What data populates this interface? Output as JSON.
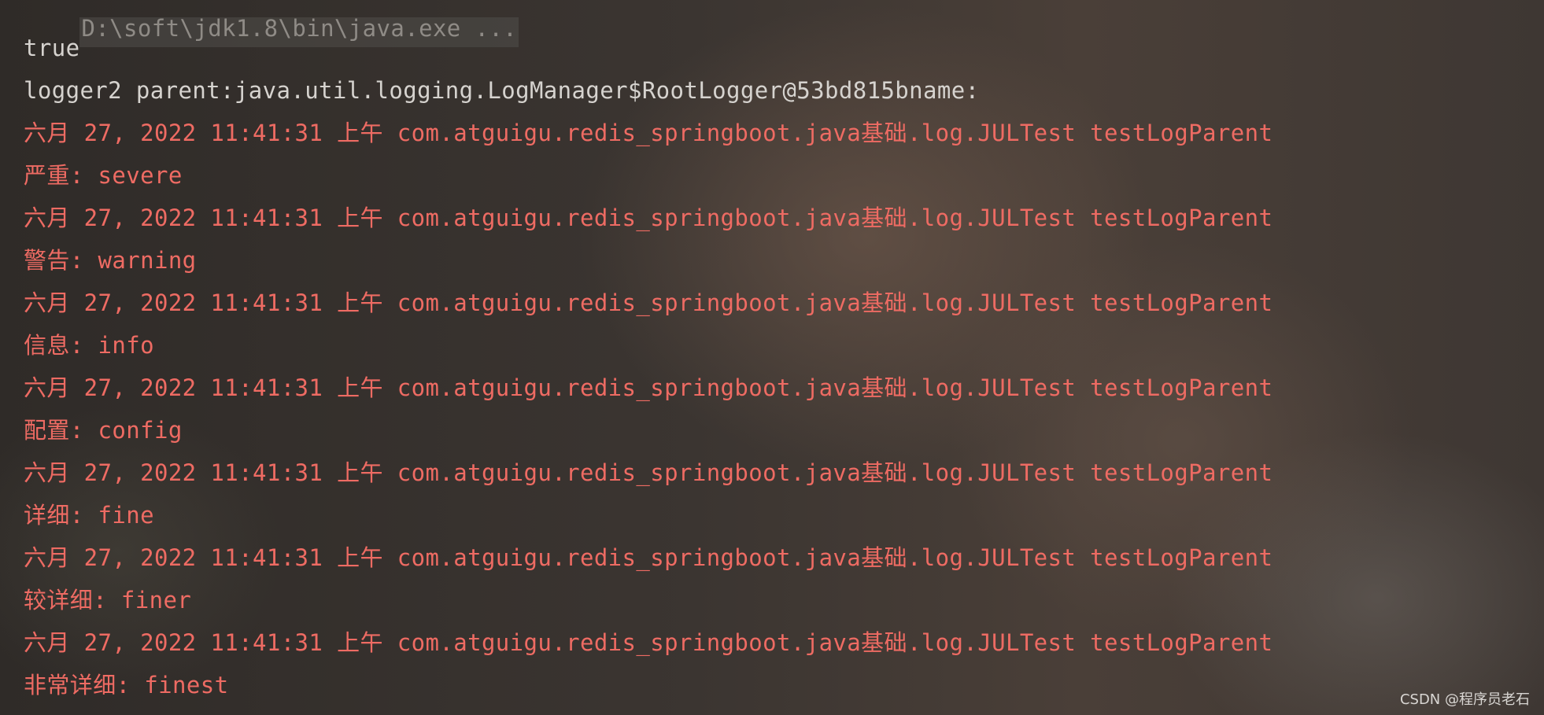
{
  "console": {
    "command": "D:\\soft\\jdk1.8\\bin\\java.exe ...",
    "stdout": [
      "true",
      "logger2 parent:java.util.logging.LogManager$RootLogger@53bd815bname:"
    ],
    "stderr": [
      "六月 27, 2022 11:41:31 上午 com.atguigu.redis_springboot.java基础.log.JULTest testLogParent",
      "严重: severe",
      "六月 27, 2022 11:41:31 上午 com.atguigu.redis_springboot.java基础.log.JULTest testLogParent",
      "警告: warning",
      "六月 27, 2022 11:41:31 上午 com.atguigu.redis_springboot.java基础.log.JULTest testLogParent",
      "信息: info",
      "六月 27, 2022 11:41:31 上午 com.atguigu.redis_springboot.java基础.log.JULTest testLogParent",
      "配置: config",
      "六月 27, 2022 11:41:31 上午 com.atguigu.redis_springboot.java基础.log.JULTest testLogParent",
      "详细: fine",
      "六月 27, 2022 11:41:31 上午 com.atguigu.redis_springboot.java基础.log.JULTest testLogParent",
      "较详细: finer",
      "六月 27, 2022 11:41:31 上午 com.atguigu.redis_springboot.java基础.log.JULTest testLogParent",
      "非常详细: finest"
    ]
  },
  "watermark": "CSDN @程序员老石",
  "colors": {
    "stdout": "#d6d3cf",
    "stderr": "#ee6b63",
    "command": "#8f8b86"
  }
}
